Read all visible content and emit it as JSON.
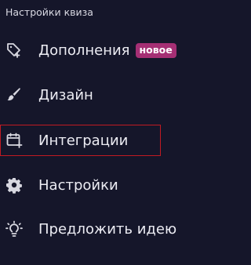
{
  "section": {
    "title": "Настройки квиза"
  },
  "menu": {
    "items": [
      {
        "label": "Дополнения",
        "icon": "tag-plus-icon",
        "badge": "новое"
      },
      {
        "label": "Дизайн",
        "icon": "brush-icon"
      },
      {
        "label": "Интеграции",
        "icon": "calendar-plus-icon",
        "selected": true
      },
      {
        "label": "Настройки",
        "icon": "gear-icon"
      },
      {
        "label": "Предложить идею",
        "icon": "lightbulb-icon"
      }
    ]
  },
  "colors": {
    "background": "#15162a",
    "badge": "#a52f74",
    "selection_outline": "#c11a22",
    "text": "#ececf3"
  }
}
